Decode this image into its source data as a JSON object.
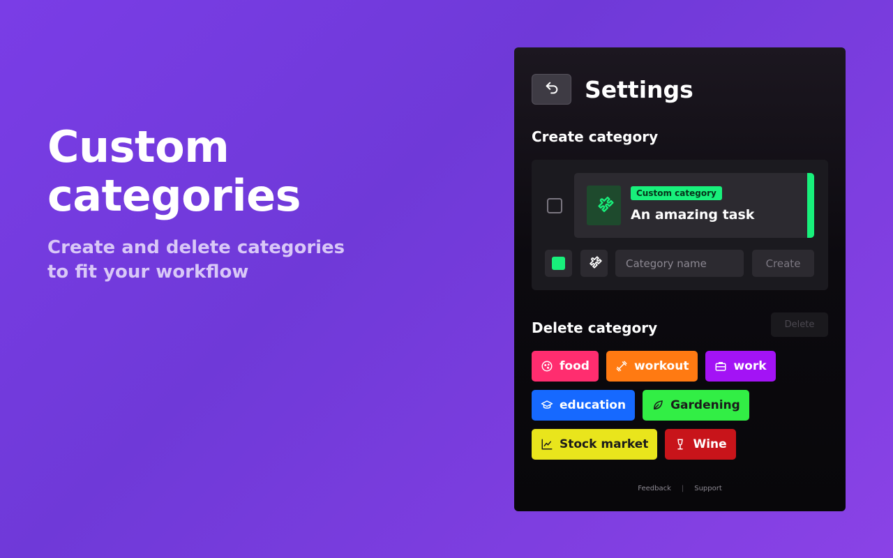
{
  "hero": {
    "title_line1": "Custom",
    "title_line2": "categories",
    "subtitle_line1": "Create and delete categories",
    "subtitle_line2": "to fit your workflow"
  },
  "settings": {
    "title": "Settings",
    "back_icon": "undo-arrow-icon",
    "create_section": {
      "title": "Create category",
      "preview": {
        "badge": "Custom category",
        "task": "An amazing task",
        "icon": "puzzle-icon",
        "accent_color": "#18f07b"
      },
      "name_placeholder": "Category name",
      "create_label": "Create"
    },
    "delete_section": {
      "title": "Delete category",
      "delete_label": "Delete"
    },
    "categories": [
      {
        "label": "food",
        "color": "#ff2d6f",
        "icon": "cookie-icon"
      },
      {
        "label": "workout",
        "color": "#ff7a12",
        "icon": "dumbbell-icon"
      },
      {
        "label": "work",
        "color": "#a313f5",
        "icon": "briefcase-icon"
      },
      {
        "label": "education",
        "color": "#1669ff",
        "icon": "graduation-cap-icon"
      },
      {
        "label": "Gardening",
        "color": "#32ee45",
        "icon": "leaf-icon"
      },
      {
        "label": "Stock market",
        "color": "#e9e51c",
        "icon": "chart-line-icon"
      },
      {
        "label": "Wine",
        "color": "#c8141a",
        "icon": "wine-glass-icon"
      }
    ],
    "footer": {
      "feedback": "Feedback",
      "separator": "|",
      "support": "Support"
    }
  }
}
